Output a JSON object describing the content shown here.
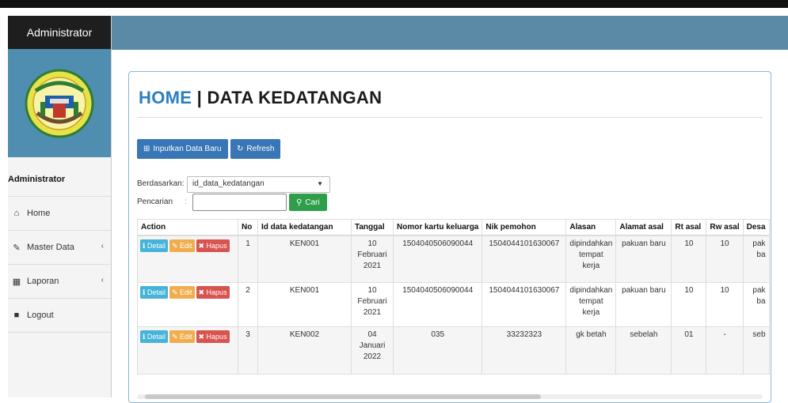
{
  "sidebar": {
    "app_title": "Administrator",
    "user_label": "Administrator",
    "items": [
      {
        "label": "Home",
        "icon": "home-icon",
        "glyph": "⌂",
        "has_chevron": false
      },
      {
        "label": "Master Data",
        "icon": "edit-icon",
        "glyph": "✎",
        "has_chevron": true
      },
      {
        "label": "Laporan",
        "icon": "calendar-icon",
        "glyph": "▦",
        "has_chevron": true
      },
      {
        "label": "Logout",
        "icon": "logout-icon",
        "glyph": "■",
        "has_chevron": false
      }
    ],
    "chevron": "‹"
  },
  "page": {
    "title_home": "HOME",
    "title_rest": " | DATA KEDATANGAN",
    "btn_new": "Inputkan Data Baru",
    "btn_refresh": "Refresh",
    "filter_label": "Berdasarkan:",
    "filter_value": "id_data_kedatangan",
    "search_label": "Pencarian",
    "search_btn": "Cari"
  },
  "table": {
    "headers": [
      "Action",
      "No",
      "Id data kedatangan",
      "Tanggal",
      "Nomor kartu keluarga",
      "Nik pemohon",
      "Alasan",
      "Alamat asal",
      "Rt asal",
      "Rw asal",
      "Desa"
    ],
    "action_labels": {
      "detail": "Detail",
      "edit": "Edit",
      "hapus": "Hapus"
    },
    "rows": [
      {
        "no": "1",
        "id": "KEN001",
        "tanggal": "10\nFebruari\n2021",
        "kk": "1504040506090044",
        "nik": "1504044101630067",
        "alasan": "dipindahkan\ntempat\nkerja",
        "alamat": "pakuan baru",
        "rt": "10",
        "rw": "10",
        "desa": "pak\nba"
      },
      {
        "no": "2",
        "id": "KEN001",
        "tanggal": "10\nFebruari\n2021",
        "kk": "1504040506090044",
        "nik": "1504044101630067",
        "alasan": "dipindahkan\ntempat\nkerja",
        "alamat": "pakuan baru",
        "rt": "10",
        "rw": "10",
        "desa": "pak\nba"
      },
      {
        "no": "3",
        "id": "KEN002",
        "tanggal": "04\nJanuari\n2022",
        "kk": "035",
        "nik": "33232323",
        "alasan": "gk betah",
        "alamat": "sebelah",
        "rt": "01",
        "rw": "-",
        "desa": "seb"
      }
    ]
  },
  "colors": {
    "topbar": "#5a8aa6",
    "accent": "#2b7fc0",
    "danger": "#d9534f",
    "success": "#2e9e48"
  }
}
